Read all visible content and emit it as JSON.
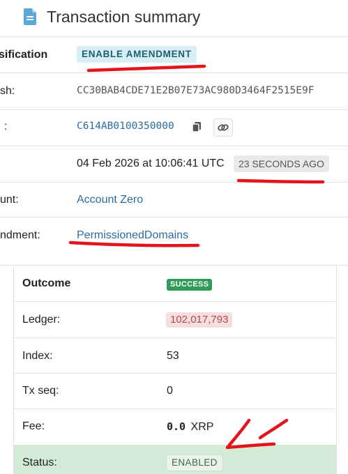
{
  "header": {
    "title": "Transaction summary",
    "icon": "document-icon"
  },
  "rows": {
    "classification": {
      "label": "sification",
      "value": "ENABLE AMENDMENT"
    },
    "hash": {
      "label": "sh:",
      "value": "CC30BAB4CDE71E2B07E73AC980D3464F2515E9F"
    },
    "ctid": {
      "label": ":",
      "value": "C614AB0100350000",
      "copy_icon": "copy-icon",
      "link_icon": "link-icon"
    },
    "time": {
      "value": "04 Feb 2026 at 10:06:41 UTC",
      "ago": "23 SECONDS AGO"
    },
    "account": {
      "label": "unt:",
      "value": "Account Zero"
    },
    "amendment": {
      "label": "ndment:",
      "value": "PermissionedDomains"
    }
  },
  "outcome": {
    "header_label": "Outcome",
    "header_value": "SUCCESS",
    "ledger_label": "Ledger:",
    "ledger_value": "102,017,793",
    "index_label": "Index:",
    "index_value": "53",
    "txseq_label": "Tx seq:",
    "txseq_value": "0",
    "fee_label": "Fee:",
    "fee_amount": "0.0",
    "fee_unit": "XRP",
    "status_label": "Status:",
    "status_value": "ENABLED"
  },
  "colors": {
    "accent_link": "#2b6c9e",
    "success": "#2f9d55",
    "annotation": "#e3141b",
    "status_row": "#d3ebd6"
  }
}
